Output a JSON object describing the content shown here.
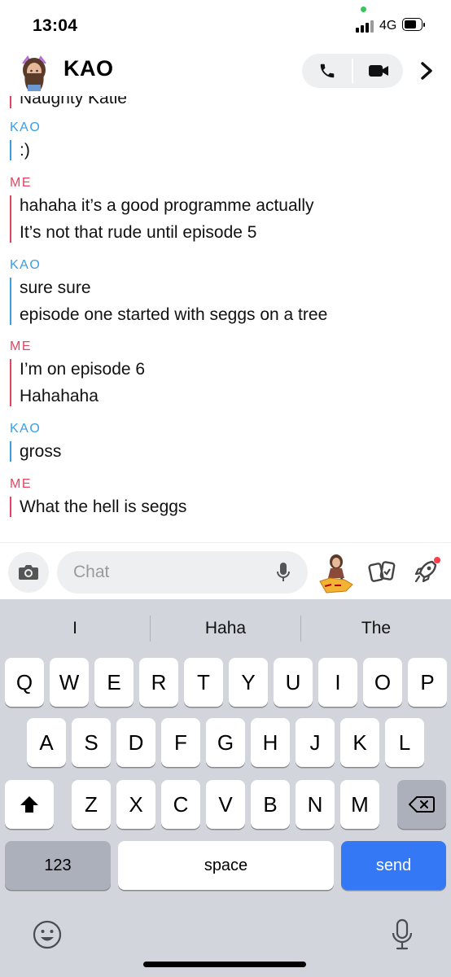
{
  "status_bar": {
    "time": "13:04",
    "network": "4G"
  },
  "header": {
    "contact_name": "KAO"
  },
  "messages": [
    {
      "sender": "KAO",
      "lines": [
        ":)"
      ]
    },
    {
      "sender": "ME",
      "lines": [
        "hahaha it’s a good programme actually",
        "It’s not that rude until episode 5"
      ]
    },
    {
      "sender": "KAO",
      "lines": [
        "sure sure",
        "episode one started with seggs on a tree"
      ]
    },
    {
      "sender": "ME",
      "lines": [
        "I’m on episode 6",
        "Hahahaha"
      ]
    },
    {
      "sender": "KAO",
      "lines": [
        "gross"
      ]
    },
    {
      "sender": "ME",
      "lines": [
        "What the hell is seggs"
      ]
    }
  ],
  "partial_message": "Naughty Katie",
  "compose": {
    "placeholder": "Chat"
  },
  "keyboard": {
    "suggestions": [
      "I",
      "Haha",
      "The"
    ],
    "row1": [
      "Q",
      "W",
      "E",
      "R",
      "T",
      "Y",
      "U",
      "I",
      "O",
      "P"
    ],
    "row2": [
      "A",
      "S",
      "D",
      "F",
      "G",
      "H",
      "J",
      "K",
      "L"
    ],
    "row3": [
      "Z",
      "X",
      "C",
      "V",
      "B",
      "N",
      "M"
    ],
    "numbers_label": "123",
    "space_label": "space",
    "send_label": "send"
  },
  "colors": {
    "kao": "#3a9ee4",
    "me": "#e44460",
    "send": "#3478f6",
    "keyboard_bg": "#d2d5db"
  },
  "icons": [
    "phone-icon",
    "video-icon",
    "chevron-right-icon",
    "camera-icon",
    "microphone-icon",
    "bitmoji-icon",
    "cards-icon",
    "rocket-icon",
    "shift-icon",
    "backspace-icon",
    "emoji-icon",
    "dictation-icon"
  ]
}
